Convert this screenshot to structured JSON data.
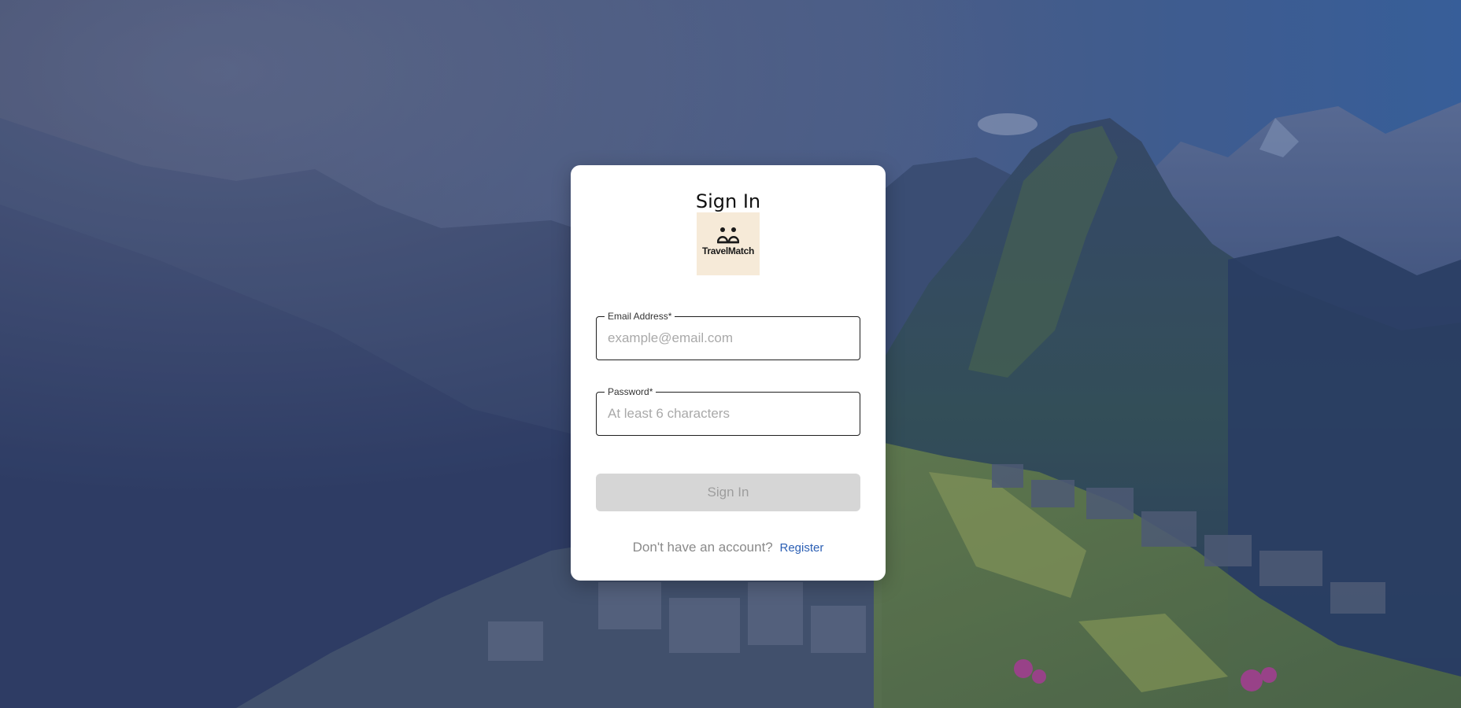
{
  "page": {
    "title": "Sign In"
  },
  "logo": {
    "text": "TravelMatch",
    "icon": "two-travelers-icon"
  },
  "form": {
    "email": {
      "label": "Email Address*",
      "placeholder": "example@email.com",
      "value": ""
    },
    "password": {
      "label": "Password*",
      "placeholder": "At least 6 characters",
      "value": ""
    },
    "submit_label": "Sign In",
    "submit_enabled": false
  },
  "footer": {
    "prompt": "Don't have an account?",
    "link_label": "Register"
  },
  "colors": {
    "accent": "#2b5fb4",
    "logo_bg": "#f6ead8",
    "button_disabled": "#d6d6d6"
  }
}
